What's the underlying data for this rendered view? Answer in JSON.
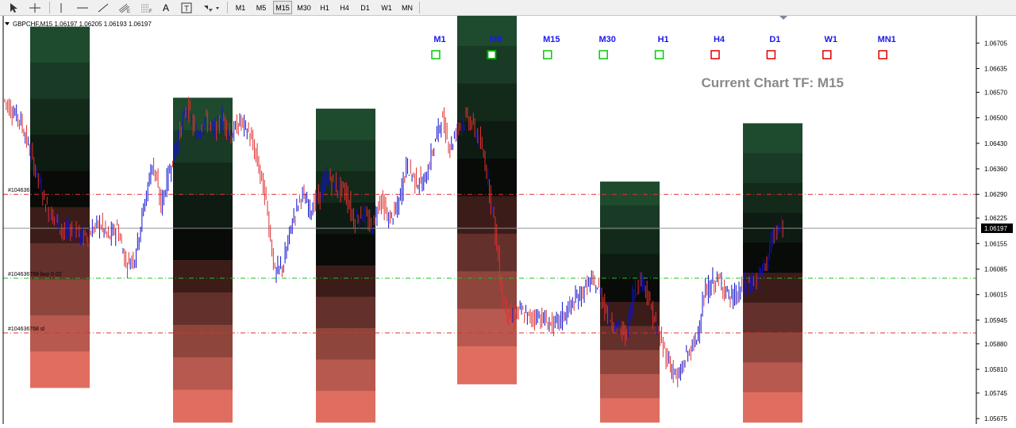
{
  "toolbar": {
    "tools": [
      {
        "name": "cursor-tool",
        "icon": "arrow-cursor-icon"
      },
      {
        "name": "crosshair-tool",
        "icon": "crosshair-icon"
      },
      {
        "name": "vertical-line-tool",
        "icon": "vertical-line-icon"
      },
      {
        "name": "horizontal-line-tool",
        "icon": "horizontal-line-icon"
      },
      {
        "name": "trendline-tool",
        "icon": "trendline-icon"
      },
      {
        "name": "equidistant-channel-tool",
        "icon": "channel-icon"
      },
      {
        "name": "fibonacci-tool",
        "icon": "fibonacci-icon"
      },
      {
        "name": "text-tool",
        "icon": "text-icon",
        "label": "A"
      },
      {
        "name": "text-label-tool",
        "icon": "text-label-icon",
        "label": "T"
      },
      {
        "name": "shapes-tool",
        "icon": "shapes-dropdown-icon"
      }
    ],
    "timeframes": [
      "M1",
      "M5",
      "M15",
      "M30",
      "H1",
      "H4",
      "D1",
      "W1",
      "MN"
    ]
  },
  "chart": {
    "header": "GBPCHF,M15  1.06197 1.06205 1.06193 1.06197",
    "current_tf_label": "Current Chart TF: M15",
    "tf_panel": [
      {
        "label": "M1",
        "state": "up"
      },
      {
        "label": "M5",
        "state": "up-active"
      },
      {
        "label": "M15",
        "state": "up"
      },
      {
        "label": "M30",
        "state": "up"
      },
      {
        "label": "H1",
        "state": "up"
      },
      {
        "label": "H4",
        "state": "down"
      },
      {
        "label": "D1",
        "state": "down"
      },
      {
        "label": "W1",
        "state": "down"
      },
      {
        "label": "MN1",
        "state": "down"
      }
    ],
    "current_price": "1.06197",
    "trade_lines": [
      {
        "label": "#104636768 tp",
        "price": 1.0629,
        "color": "#e03030"
      },
      {
        "label": "#104636768 buy 0.02",
        "price": 1.0606,
        "color": "#20c020"
      },
      {
        "label": "#104636768 sl",
        "price": 1.0591,
        "color": "#e03030"
      }
    ],
    "colors": {
      "bull_candle": "#1010d0",
      "bear_candle": "#e03030",
      "tf_up": "#00cc00",
      "tf_down": "#dd0000",
      "tf_label": "#1a1aee",
      "zone_top": "#1e4a30",
      "zone_bottom": "#e07060"
    }
  },
  "chart_data": {
    "type": "line",
    "symbol": "GBPCHF",
    "timeframe": "M15",
    "y_ticks": [
      "1.06705",
      "1.06635",
      "1.06570",
      "1.06500",
      "1.06430",
      "1.06360",
      "1.06290",
      "1.06225",
      "1.06155",
      "1.06085",
      "1.06015",
      "1.05945",
      "1.05880",
      "1.05810",
      "1.05745",
      "1.05675"
    ],
    "ylim": [
      1.0566,
      1.0676
    ],
    "close_series": [
      1.0655,
      1.0652,
      1.0649,
      1.0641,
      1.0633,
      1.0625,
      1.0622,
      1.0618,
      1.062,
      1.0617,
      1.0619,
      1.0621,
      1.0617,
      1.062,
      1.061,
      1.0612,
      1.0625,
      1.0638,
      1.0626,
      1.0636,
      1.0645,
      1.0653,
      1.0645,
      1.065,
      1.0646,
      1.065,
      1.0645,
      1.0649,
      1.0646,
      1.0638,
      1.0627,
      1.0607,
      1.061,
      1.0622,
      1.0629,
      1.0625,
      1.0628,
      1.0634,
      1.0631,
      1.063,
      1.0622,
      1.0624,
      1.062,
      1.0628,
      1.0622,
      1.0625,
      1.0637,
      1.0633,
      1.0632,
      1.0641,
      1.065,
      1.0642,
      1.0648,
      1.065,
      1.0646,
      1.0638,
      1.0622,
      1.06,
      1.0595,
      1.0597,
      1.0595,
      1.0596,
      1.0594,
      1.0593,
      1.0596,
      1.0599,
      1.0602,
      1.0605,
      1.0603,
      1.0596,
      1.0593,
      1.059,
      1.0603,
      1.0606,
      1.0597,
      1.0589,
      1.0583,
      1.0578,
      1.0585,
      1.0588,
      1.0601,
      1.0605,
      1.0605,
      1.06,
      1.0602,
      1.0605,
      1.0605,
      1.061,
      1.0618,
      1.062
    ],
    "zones": [
      {
        "top": 1.0675,
        "bottom": 1.0576
      },
      {
        "top": 1.06555,
        "bottom": 1.05665
      },
      {
        "top": 1.06525,
        "bottom": 1.05665
      },
      {
        "top": 1.068,
        "bottom": 1.0577
      },
      {
        "top": 1.06325,
        "bottom": 1.05665
      },
      {
        "top": 1.06485,
        "bottom": 1.05665
      }
    ]
  }
}
